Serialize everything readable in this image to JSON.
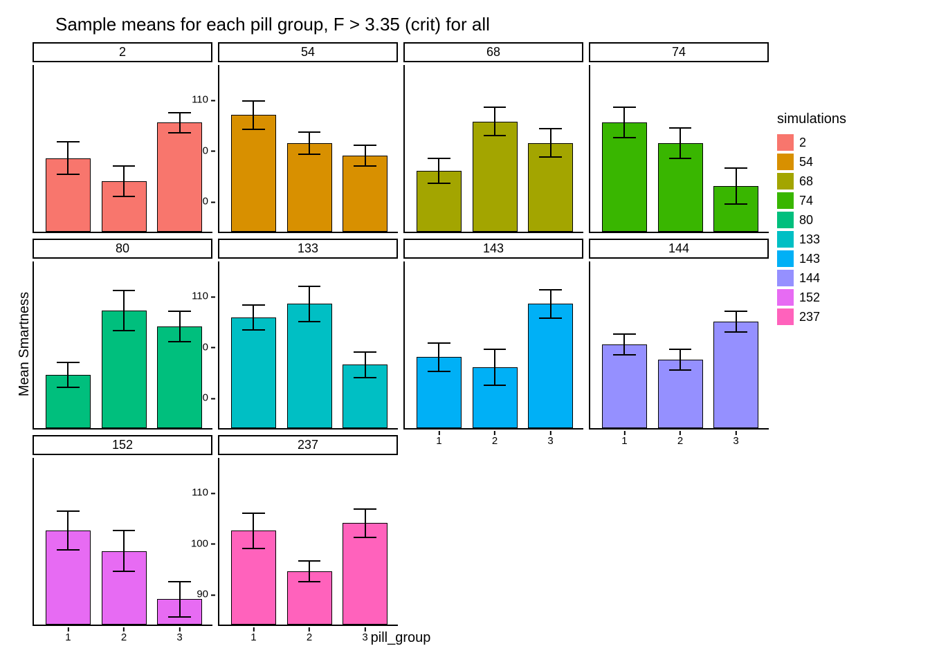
{
  "chart_data": {
    "type": "bar",
    "title": "Sample means for each pill group, F > 3.35 (crit) for all",
    "xlabel": "pill_group",
    "ylabel": "Mean Smartness",
    "ylim": [
      84,
      114
    ],
    "yticks": [
      90,
      100,
      110
    ],
    "xticks": [
      "1",
      "2",
      "3"
    ],
    "legend_title": "simulations",
    "series_colors": {
      "2": "#F8766D",
      "54": "#D89000",
      "68": "#A3A500",
      "74": "#39B600",
      "80": "#00BF7D",
      "133": "#00BFC4",
      "143": "#00B0F6",
      "144": "#9590FF",
      "152": "#E76BF3",
      "237": "#FF62BC"
    },
    "facets": [
      {
        "sim": "2",
        "means": [
          98.5,
          94.0,
          105.5
        ],
        "err": [
          3.2,
          3.0,
          2.0
        ]
      },
      {
        "sim": "54",
        "means": [
          107.0,
          101.5,
          99.0
        ],
        "err": [
          2.8,
          2.2,
          2.0
        ]
      },
      {
        "sim": "68",
        "means": [
          96.0,
          105.7,
          101.5
        ],
        "err": [
          2.5,
          2.8,
          2.8
        ]
      },
      {
        "sim": "74",
        "means": [
          105.5,
          101.5,
          93.0
        ],
        "err": [
          3.0,
          3.0,
          3.5
        ]
      },
      {
        "sim": "80",
        "means": [
          94.5,
          107.2,
          104.0
        ],
        "err": [
          2.5,
          4.0,
          3.0
        ]
      },
      {
        "sim": "133",
        "means": [
          105.8,
          108.5,
          96.5
        ],
        "err": [
          2.5,
          3.5,
          2.5
        ]
      },
      {
        "sim": "143",
        "means": [
          98.0,
          96.0,
          108.5
        ],
        "err": [
          2.8,
          3.5,
          2.8
        ]
      },
      {
        "sim": "144",
        "means": [
          100.5,
          97.5,
          105.0
        ],
        "err": [
          2.0,
          2.0,
          2.0
        ]
      },
      {
        "sim": "152",
        "means": [
          102.5,
          98.5,
          89.0
        ],
        "err": [
          3.8,
          4.0,
          3.5
        ]
      },
      {
        "sim": "237",
        "means": [
          102.5,
          94.5,
          104.0
        ],
        "err": [
          3.5,
          2.0,
          2.8
        ]
      }
    ]
  }
}
